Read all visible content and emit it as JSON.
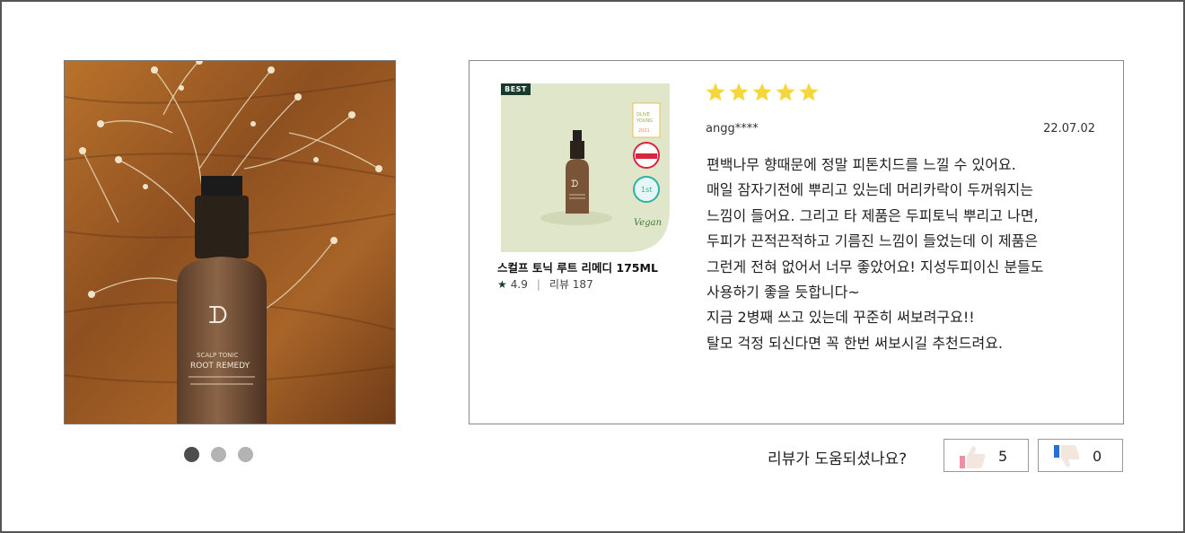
{
  "product_photo": {
    "alt_icon": "product-photo"
  },
  "carousel": {
    "dots": 3,
    "active_index": 0
  },
  "review": {
    "badge": "BEST",
    "product_name": "스컬프 토닉 루트 리메디 175ML",
    "rating_avg": "4.9",
    "review_count_text": "리뷰 187",
    "separator": "|",
    "star_rating": 5,
    "reviewer": "angg****",
    "date": "22.07.02",
    "text_lines": [
      "편백나무 향때문에 정말 피톤치드를 느낄 수 있어요.",
      "매일 잠자기전에 뿌리고 있는데 머리카락이 두꺼워지는",
      "느낌이 들어요. 그리고 타 제품은 두피토닉 뿌리고 나면,",
      "두피가 끈적끈적하고 기름진 느낌이 들었는데 이 제품은",
      "그런게 전혀 없어서 너무 좋았어요! 지성두피이신 분들도",
      "사용하기 좋을 듯합니다~",
      "지금 2병째 쓰고 있는데 꾸준히 써보려구요!!",
      "탈모 걱정 되신다면 꼭 한번 써보시길 추천드려요."
    ]
  },
  "helpful": {
    "question": "리뷰가 도움되셨나요?",
    "up_count": "5",
    "down_count": "0"
  },
  "colors": {
    "star": "#f5d63d",
    "badge": "#173b2c",
    "accent_pink": "#ee8fa6",
    "accent_blue": "#2b6fd6"
  }
}
